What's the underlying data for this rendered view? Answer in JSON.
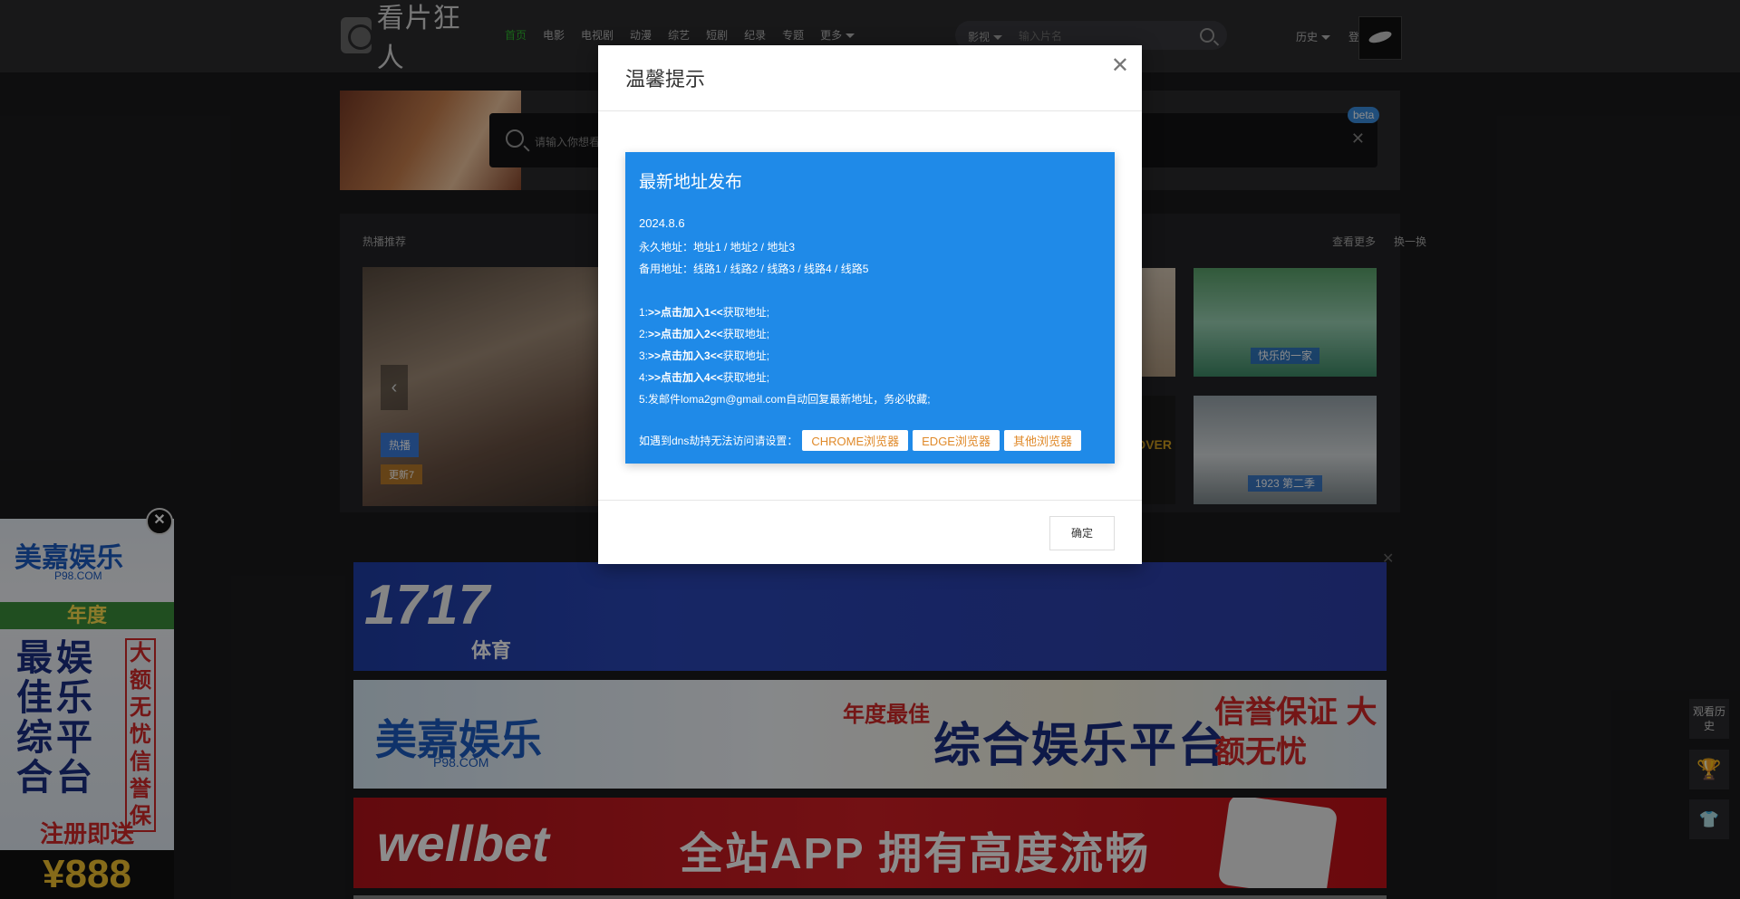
{
  "header": {
    "logo_text": "看片狂人",
    "nav": [
      "首页",
      "电影",
      "电视剧",
      "动漫",
      "综艺",
      "短剧",
      "纪录",
      "专题",
      "更多"
    ],
    "search_type": "影视",
    "search_placeholder": "输入片名",
    "right_links": [
      "历史",
      "登录"
    ]
  },
  "banner": {
    "placeholder": "请输入你想看的影片名称",
    "badge": "beta"
  },
  "section": {
    "title": "热播推荐",
    "more_links": [
      "查看更多",
      "换一换"
    ],
    "feature_tag": "热播",
    "feature_sub": "更新7",
    "thumbs": [
      {
        "caption": "快乐的一家"
      },
      {
        "caption": "1923 第二季"
      }
    ],
    "poster_text": "UNDERCOVER school"
  },
  "ads": {
    "ad1_title": "1717",
    "ad1_sub": "体育",
    "ad2_brand": "美嘉娱乐",
    "ad2_domain": "P98.COM",
    "ad2_year": "年度最佳",
    "ad2_main": "综合娱乐平台",
    "ad2_gift": "注册即送",
    "ad2_amount": "¥888",
    "ad2_trust": "信誉保证 大额无忧",
    "ad3_brand": "wellbet",
    "ad3_main": "全站APP 拥有高度流畅",
    "left_brand": "美嘉娱乐",
    "left_domain": "P98.COM",
    "left_year": "年度",
    "left_v1": "最佳综合",
    "left_v2": "娱乐平台",
    "left_v3": "大额无忧信誉保",
    "left_reg": "注册即送",
    "left_amount": "¥888"
  },
  "tools": {
    "history": "观看历史"
  },
  "modal": {
    "title": "温馨提示",
    "notice_title": "最新地址发布",
    "date": "2024.8.6",
    "line1": "永久地址：地址1 / 地址2 / 地址3",
    "line2": "备用地址：线路1 / 线路2 / 线路3 / 线路4 / 线路5",
    "items": [
      {
        "num": "1:",
        "bold": ">>点击加入1<<",
        "tail": "获取地址;"
      },
      {
        "num": "2:",
        "bold": ">>点击加入2<<",
        "tail": "获取地址;"
      },
      {
        "num": "3:",
        "bold": ">>点击加入3<<",
        "tail": "获取地址;"
      },
      {
        "num": "4:",
        "bold": ">>点击加入4<<",
        "tail": "获取地址;"
      }
    ],
    "item5": "5:发邮件loma2gm@gmail.com自动回复最新地址，务必收藏;",
    "dns_text": "如遇到dns劫持无法访问请设置：",
    "buttons": [
      "CHROME浏览器",
      "EDGE浏览器",
      "其他浏览器"
    ],
    "ok": "确定"
  },
  "colors": {
    "accent_green": "#2eb82e",
    "notice_blue": "#1f8ae8",
    "button_text_orange": "#e08a2a"
  }
}
